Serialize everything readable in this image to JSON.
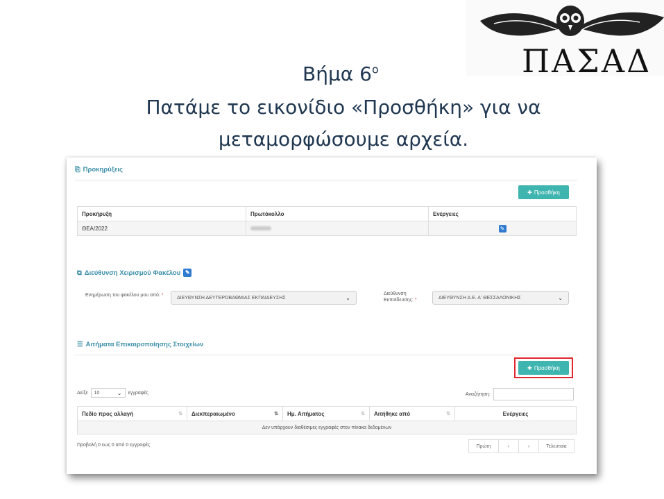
{
  "slide": {
    "step": "Βήμα 6",
    "step_sup": "ο",
    "line2": "Πατάμε το εικονίδιο «Προσθήκη» για να",
    "line3": "μεταμορφώσουμε αρχεία.",
    "logo_text": "ΠΑΣΑΔ"
  },
  "announcements": {
    "title": "Προκηρύξεις",
    "add_button": "Προσθήκη",
    "columns": [
      "Προκήρυξη",
      "Πρωτόκολλο",
      "Ενέργειες"
    ],
    "rows": [
      {
        "announcement": "ΘΕΑ/2022"
      }
    ]
  },
  "folder_management": {
    "title": "Διεύθυνση Χειρισμού Φακέλου",
    "field1_label": "Ενημέρωση του φακέλου μου από:",
    "field1_value": "ΔΙΕΥΘΥΝΣΗ ΔΕΥΤΕΡΟΒΑΘΜΙΑΣ ΕΚΠΑΙΔΕΥΣΗΣ",
    "field2_label": "Διεύθυνση Εκπαίδευσης:",
    "field2_value": "ΔΙΕΥΘΥΝΣΗ Δ.Ε. Α' ΘΕΣΣΑΛΟΝΙΚΗΣ",
    "required_mark": "*"
  },
  "update_requests": {
    "title": "Αιτήματα Επικαιροποίησης Στοιχείων",
    "add_button": "Προσθήκη",
    "show_label": "Δείξε",
    "page_size": "10",
    "entries_label": "εγγραφές",
    "search_label": "Αναζήτηση:",
    "columns": [
      "Πεδίο προς αλλαγή",
      "Διεκπεραιωμένο",
      "Ημ. Αιτήματος",
      "Αιτήθηκε από",
      "Ενέργειες"
    ],
    "empty_message": "Δεν υπάρχουν διαθέσιμες εγγραφές στον πίνακα δεδομένων",
    "info": "Προβολή 0 εως 0 από 0 εγγραφές",
    "pager": {
      "first": "Πρώτη",
      "prev": "‹",
      "next": "›",
      "last": "Τελευταία"
    }
  },
  "colors": {
    "accent": "#3fb5b0",
    "title": "#1f3750",
    "highlight": "#e0262e"
  }
}
